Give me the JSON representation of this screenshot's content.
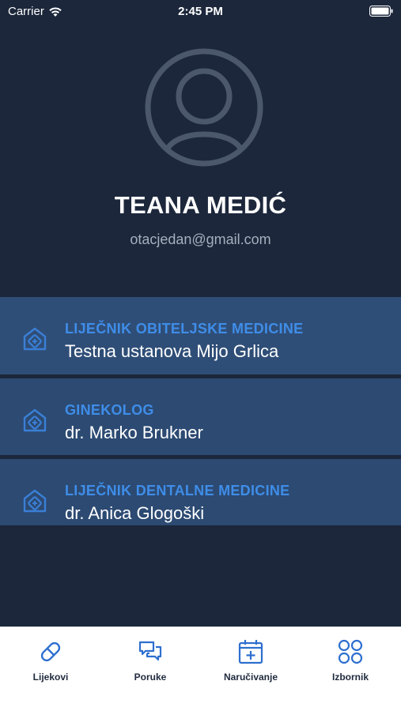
{
  "status_bar": {
    "carrier": "Carrier",
    "time": "2:45 PM"
  },
  "profile": {
    "name": "TEANA MEDIĆ",
    "email": "otacjedan@gmail.com"
  },
  "doctors": [
    {
      "role": "LIJEČNIK OBITELJSKE MEDICINE",
      "name": "Testna ustanova Mijo Grlica"
    },
    {
      "role": "GINEKOLOG",
      "name": "dr. Marko Brukner"
    },
    {
      "role": "LIJEČNIK DENTALNE MEDICINE",
      "name": "dr. Anica Glogoški"
    }
  ],
  "tabs": [
    {
      "label": "Lijekovi",
      "icon": "pill-icon"
    },
    {
      "label": "Poruke",
      "icon": "chat-icon"
    },
    {
      "label": "Naručivanje",
      "icon": "calendar-plus-icon"
    },
    {
      "label": "Izbornik",
      "icon": "grid-icon"
    }
  ],
  "colors": {
    "background": "#1c273b",
    "card": "#2c4a72",
    "accent": "#3f8de8",
    "tab_icon": "#2e6fcf"
  }
}
